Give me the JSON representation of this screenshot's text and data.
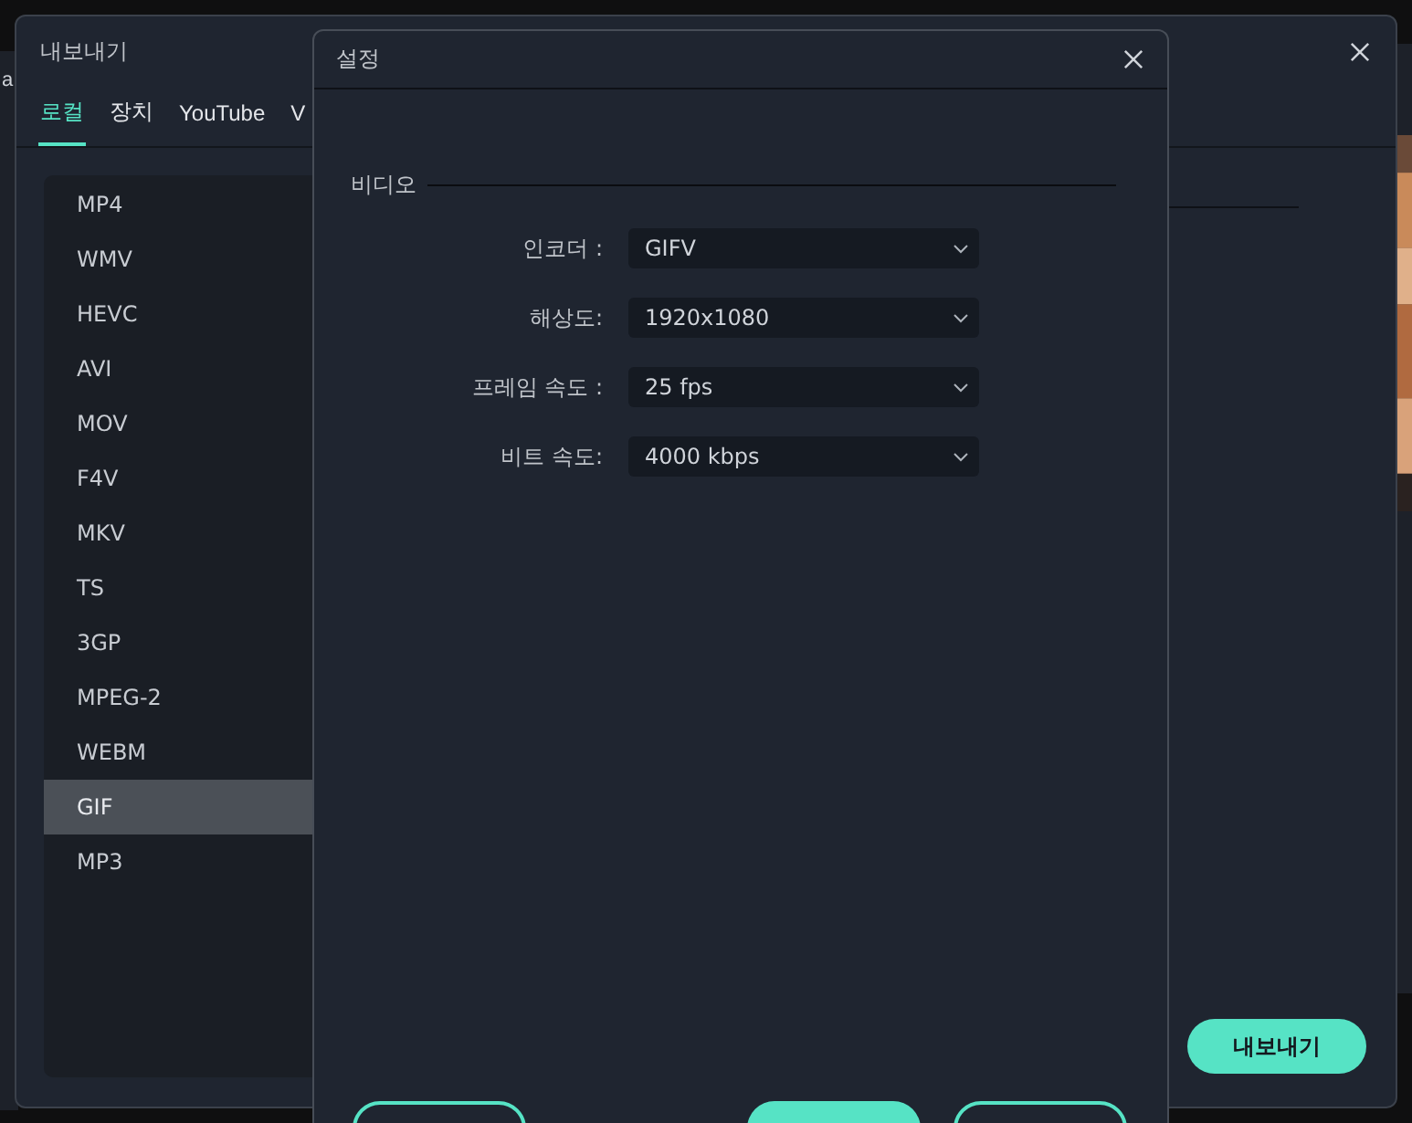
{
  "background_app": {
    "text": "a"
  },
  "export_dialog": {
    "title": "내보내기",
    "tabs": [
      {
        "label": "로컬",
        "selected": true
      },
      {
        "label": "장치",
        "selected": false
      },
      {
        "label": "YouTube",
        "selected": false
      },
      {
        "label": "V",
        "selected": false
      }
    ],
    "formats": [
      {
        "label": "MP4",
        "selected": false
      },
      {
        "label": "WMV",
        "selected": false
      },
      {
        "label": "HEVC",
        "selected": false
      },
      {
        "label": "AVI",
        "selected": false
      },
      {
        "label": "MOV",
        "selected": false
      },
      {
        "label": "F4V",
        "selected": false
      },
      {
        "label": "MKV",
        "selected": false
      },
      {
        "label": "TS",
        "selected": false
      },
      {
        "label": "3GP",
        "selected": false
      },
      {
        "label": "MPEG-2",
        "selected": false
      },
      {
        "label": "WEBM",
        "selected": false
      },
      {
        "label": "GIF",
        "selected": true
      },
      {
        "label": "MP3",
        "selected": false
      }
    ],
    "export_button": "내보내기"
  },
  "settings_dialog": {
    "title": "설정",
    "section": "비디오",
    "fields": [
      {
        "label": "인코더 :",
        "value": "GIFV"
      },
      {
        "label": "해상도:",
        "value": "1920x1080"
      },
      {
        "label": "프레임 속도 :",
        "value": "25 fps"
      },
      {
        "label": "비트 속도:",
        "value": "4000 kbps"
      }
    ],
    "footer_buttons": [
      {
        "kind": "outline"
      },
      {
        "kind": "filled"
      },
      {
        "kind": "outline"
      }
    ]
  }
}
